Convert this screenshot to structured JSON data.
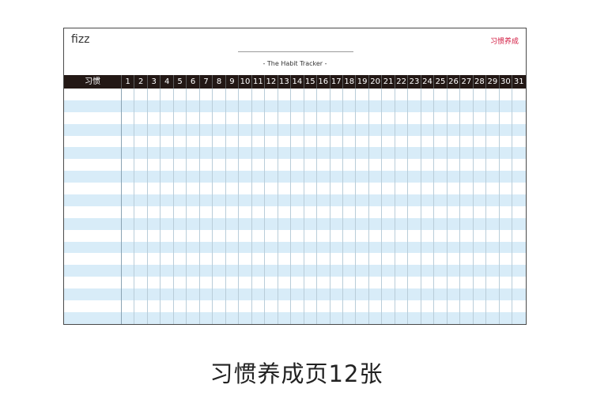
{
  "card": {
    "brand": "fizz",
    "tag": "习惯养成",
    "subtitle": "- The Habit Tracker -"
  },
  "tracker": {
    "habit_header": "习惯",
    "days": [
      "1",
      "2",
      "3",
      "4",
      "5",
      "6",
      "7",
      "8",
      "9",
      "10",
      "11",
      "12",
      "13",
      "14",
      "15",
      "16",
      "17",
      "18",
      "19",
      "20",
      "21",
      "22",
      "23",
      "24",
      "25",
      "26",
      "27",
      "28",
      "29",
      "30",
      "31"
    ],
    "row_count": 20
  },
  "caption": "习惯养成页12张",
  "colors": {
    "header_bg": "#231815",
    "stripe": "#d8ecf8",
    "tag": "#d2183f"
  }
}
